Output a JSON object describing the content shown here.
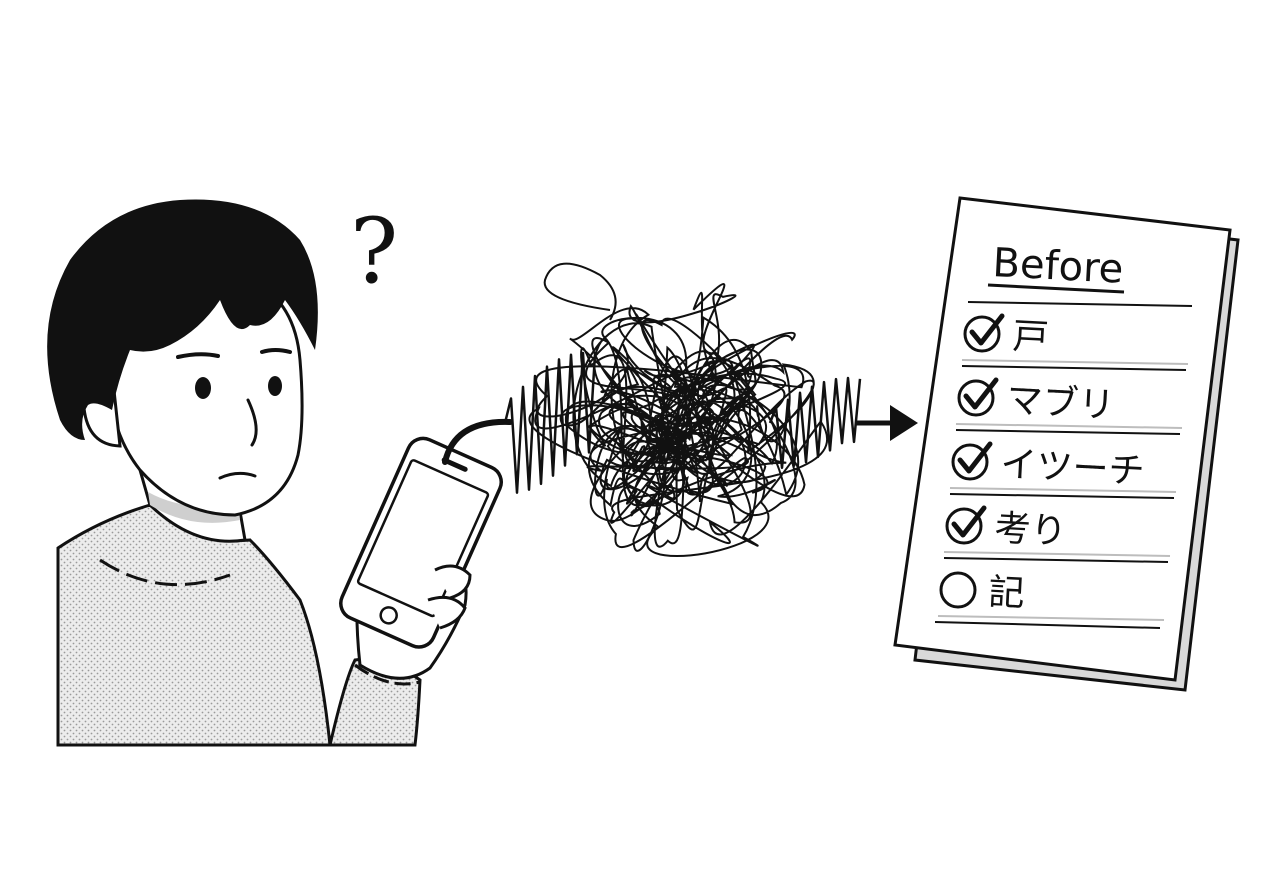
{
  "colors": {
    "ink": "#111111",
    "paper": "#ffffff",
    "sweater": "#e6e6e6",
    "shadow": "#cfcfcf",
    "rule": "#bdbdbd"
  },
  "person": {
    "expression": "confused",
    "thought_symbol": "?"
  },
  "device": {
    "type": "smartphone"
  },
  "signal": {
    "style": "tangled-scribble-waveform"
  },
  "document": {
    "title": "Before",
    "items": [
      {
        "label": "戸",
        "checked": true
      },
      {
        "label": "マブリ",
        "checked": true
      },
      {
        "label": "イツーチ",
        "checked": true
      },
      {
        "label": "考り",
        "checked": true
      },
      {
        "label": "記",
        "checked": false
      }
    ]
  }
}
